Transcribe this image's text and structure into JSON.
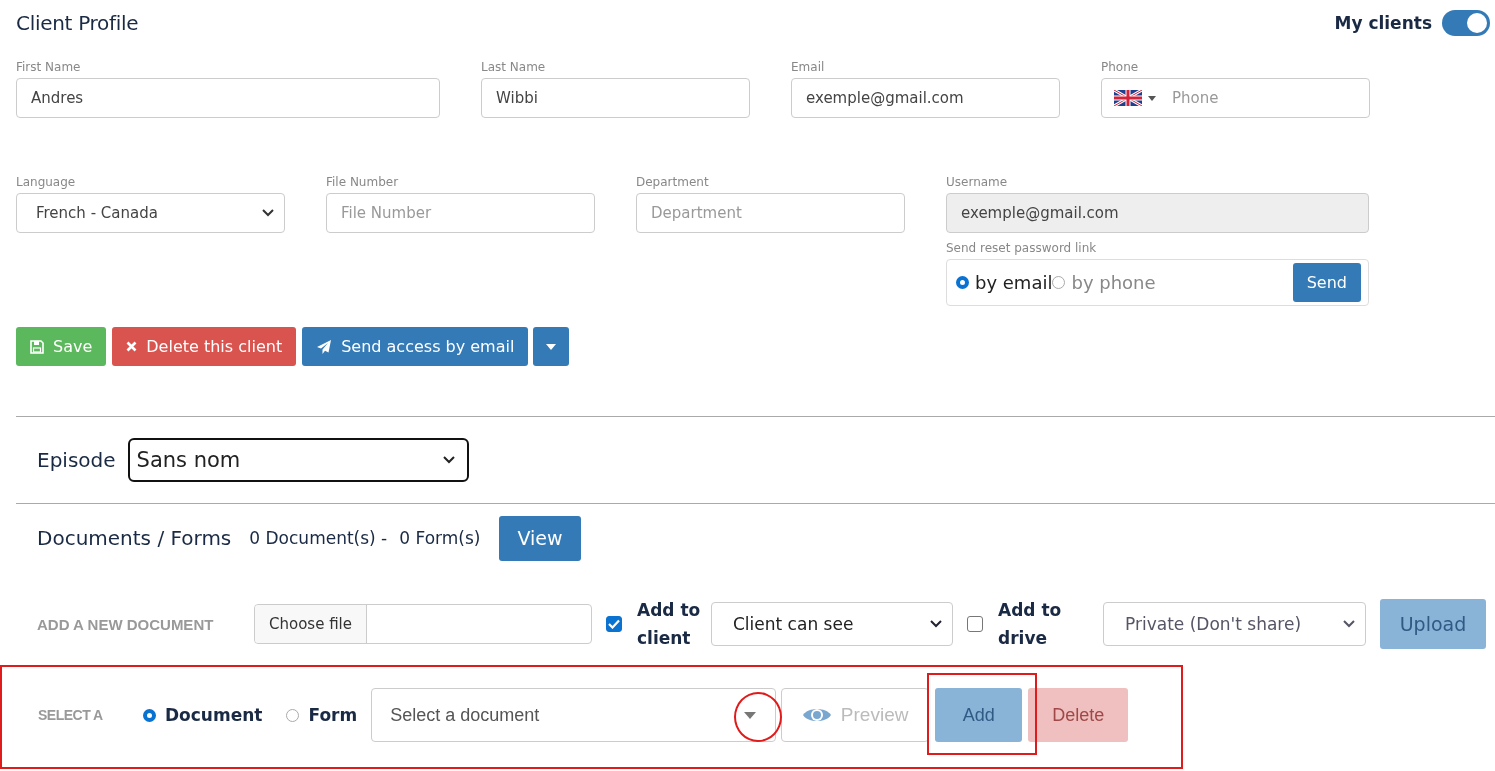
{
  "header": {
    "title": "Client Profile",
    "toggle": {
      "label": "My clients",
      "on": true
    }
  },
  "field_rows": [
    [
      {
        "kind": "text",
        "label": "First Name",
        "value": "Andres"
      },
      {
        "kind": "text",
        "label": "Last Name",
        "value": "Wibbi"
      },
      {
        "kind": "text",
        "label": "Email",
        "value": "exemple@gmail.com"
      },
      {
        "kind": "phone",
        "label": "Phone",
        "placeholder": "Phone"
      }
    ],
    [
      {
        "kind": "select",
        "label": "Language",
        "value": "French - Canada"
      },
      {
        "kind": "text",
        "label": "File Number",
        "placeholder": "File Number"
      },
      {
        "kind": "text",
        "label": "Department",
        "placeholder": "Department"
      },
      {
        "kind": "text",
        "label": "Username",
        "value": "exemple@gmail.com",
        "disabled": true
      }
    ]
  ],
  "reset_link": {
    "label": "Send reset password link",
    "options": [
      {
        "label": "by email",
        "selected": true
      },
      {
        "label": "by phone",
        "selected": false
      }
    ],
    "button": "Send"
  },
  "actions": [
    {
      "kind": "save",
      "label": "Save"
    },
    {
      "kind": "delete",
      "label": "Delete this client"
    },
    {
      "kind": "send",
      "label": "Send access by email"
    },
    {
      "kind": "dropdown"
    }
  ],
  "episode": {
    "label": "Episode",
    "value": "Sans nom"
  },
  "documents": {
    "title": "Documents / Forms",
    "documents_count": "0 Document(s) -",
    "forms_count": "0 Form(s)",
    "view_button": "View"
  },
  "add_document": {
    "label": "ADD A NEW DOCUMENT",
    "file_button": "Choose file",
    "add_to_client": {
      "label": "Add to client",
      "checked": true
    },
    "visibility": "Client can see",
    "add_to_drive": {
      "label": "Add to drive",
      "checked": false
    },
    "sharing": "Private (Don't share)",
    "upload": {
      "label": "Upload",
      "disabled": true
    }
  },
  "select_a": {
    "label": "SELECT A",
    "options": [
      {
        "label": "Document",
        "selected": true
      },
      {
        "label": "Form",
        "selected": false
      }
    ],
    "placeholder": "Select a document",
    "preview": {
      "label": "Preview",
      "disabled": true
    },
    "add": {
      "label": "Add",
      "disabled": true
    },
    "delete": {
      "label": "Delete",
      "disabled": true
    }
  }
}
